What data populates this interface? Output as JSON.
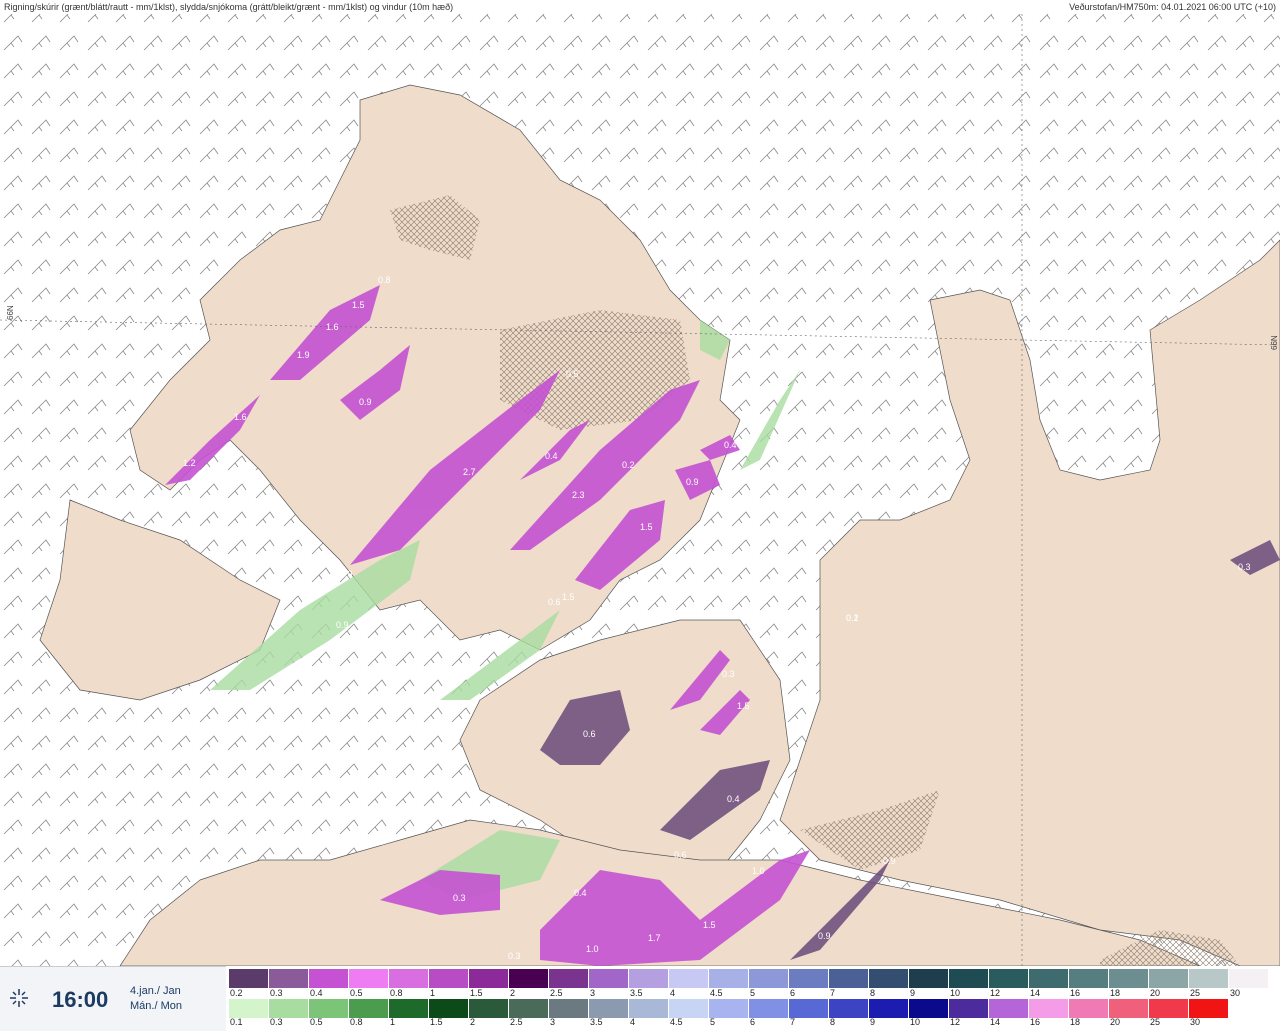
{
  "header": {
    "title": "Rigning/skúrir (grænt/blátt/rautt - mm/1klst), slydda/snjókoma (grátt/bleikt/grænt - mm/1klst) og vindur (10m hæð)",
    "source": "Veðurstofan/HM750m: 04.01.2021 06:00 UTC (+10)"
  },
  "map": {
    "latitude_label": "66N",
    "precip_labels": [
      "0.8",
      "1.5",
      "1.6",
      "1.9",
      "0.9",
      "1.6",
      "1.2",
      "2.7",
      "0.5",
      "0.4",
      "2.3",
      "1.5",
      "0.4",
      "0.9",
      "0.6",
      "0.9",
      "0.3",
      "1.5",
      "0.6",
      "0.4",
      "0.6",
      "0.3",
      "0.4",
      "1.0",
      "1.7",
      "1.5",
      "1.0",
      "0.9",
      "0.9",
      "0.3",
      "0.2",
      "0.3",
      "0.8",
      "1.5",
      "0.9",
      "0.2",
      "0.1"
    ]
  },
  "footer": {
    "time": "16:00",
    "date_line1": "4.jan./ Jan",
    "date_line2": "Mán./ Mon",
    "snow_scale": {
      "labels": [
        "0.2",
        "0.3",
        "0.4",
        "0.5",
        "0.8",
        "1",
        "1.5",
        "2",
        "2.5",
        "3",
        "3.5",
        "4",
        "4.5",
        "5",
        "6",
        "7",
        "8",
        "9",
        "10",
        "12",
        "14",
        "16",
        "18",
        "20",
        "25",
        "30"
      ],
      "colors": [
        "#5a3b6a",
        "#8a5a9a",
        "#c452d2",
        "#ee7cf2",
        "#d86ee0",
        "#b84cc4",
        "#8c2a9a",
        "#4a0052",
        "#7a3490",
        "#a266c8",
        "#b4a0e0",
        "#c8c8f4",
        "#a8b0e8",
        "#8c98d8",
        "#6c7cc0",
        "#4c6098",
        "#344e72",
        "#1e3e4e",
        "#1e4c52",
        "#2a5c5e",
        "#3e6c6e",
        "#567e80",
        "#6c8e90",
        "#8ca6a8",
        "#b8c8c8",
        "#f4f0f4"
      ]
    },
    "rain_scale": {
      "labels": [
        "0.1",
        "0.3",
        "0.5",
        "0.8",
        "1",
        "1.5",
        "2",
        "2.5",
        "3",
        "3.5",
        "4",
        "4.5",
        "5",
        "6",
        "7",
        "8",
        "9",
        "10",
        "12",
        "14",
        "16",
        "18",
        "20",
        "25",
        "30"
      ],
      "colors": [
        "#d4f4cc",
        "#a8dca0",
        "#7cc478",
        "#4c9c50",
        "#1e6a2a",
        "#0c4a1a",
        "#2a5a3a",
        "#4a6a5a",
        "#6a7a80",
        "#8c9ab0",
        "#aab8d8",
        "#c8d4f4",
        "#a8b4f0",
        "#8090e4",
        "#5868d4",
        "#3c44c4",
        "#1c1cb0",
        "#0a0a8c",
        "#4c2c9c",
        "#b466d8",
        "#f49ce8",
        "#f07ab4",
        "#f0607a",
        "#f03a4c",
        "#f01414"
      ]
    }
  }
}
